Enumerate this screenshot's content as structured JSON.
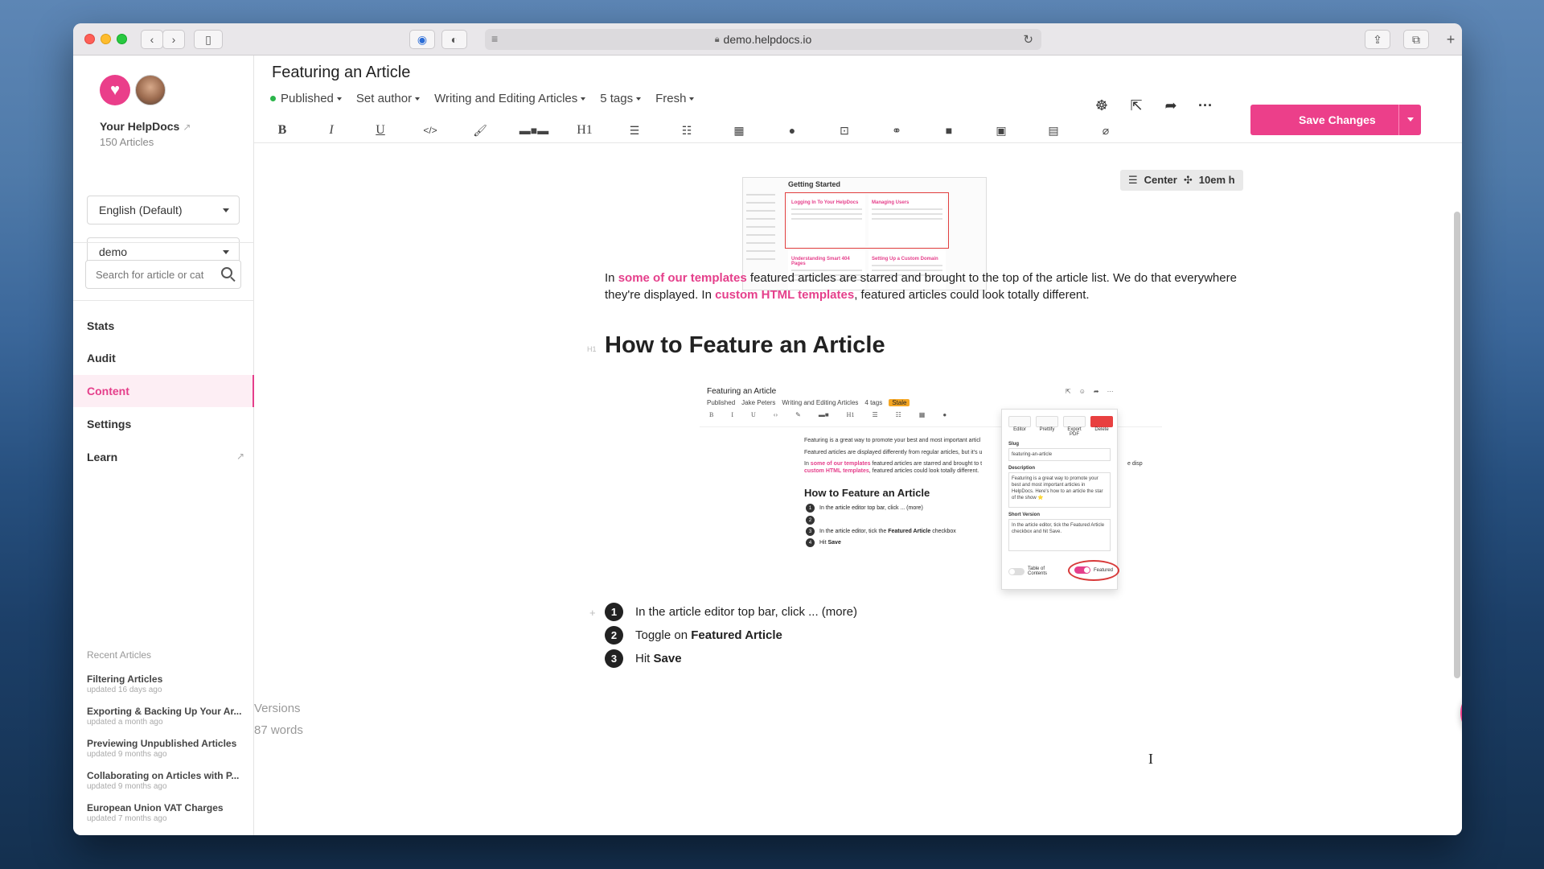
{
  "browser": {
    "url": "demo.helpdocs.io"
  },
  "sidebar": {
    "site_name": "Your HelpDocs",
    "article_count": "150 Articles",
    "language": "English (Default)",
    "site_select": "demo",
    "search_placeholder": "Search for article or cat",
    "nav": [
      {
        "label": "Stats"
      },
      {
        "label": "Audit"
      },
      {
        "label": "Content"
      },
      {
        "label": "Settings"
      },
      {
        "label": "Learn"
      }
    ],
    "recent_heading": "Recent Articles",
    "recent": [
      {
        "title": "Filtering Articles",
        "updated": "updated 16 days ago"
      },
      {
        "title": "Exporting & Backing Up Your Ar...",
        "updated": "updated a month ago"
      },
      {
        "title": "Previewing Unpublished Articles",
        "updated": "updated 9 months ago"
      },
      {
        "title": "Collaborating on Articles with P...",
        "updated": "updated 9 months ago"
      },
      {
        "title": "European Union VAT Charges",
        "updated": "updated 7 months ago"
      }
    ]
  },
  "editor": {
    "title": "Featuring an Article",
    "meta": {
      "status": "Published",
      "author": "Set author",
      "category": "Writing and Editing Articles",
      "tags": "5 tags",
      "freshness": "Fresh"
    },
    "format_buttons": [
      "B",
      "I",
      "U",
      "</>",
      "H1"
    ],
    "save_label": "Save Changes",
    "image_toolbar": {
      "align": "Center",
      "size": "10em h"
    },
    "thumb1": {
      "heading": "Getting Started",
      "cards": [
        "Logging In To Your HelpDocs",
        "Managing Users",
        "Understanding Smart 404 Pages",
        "Setting Up a Custom Domain"
      ]
    },
    "paragraph": {
      "p1": "In ",
      "link1": "some of our templates",
      "p2": " featured articles are starred and brought to the top of the article list. We do that everywhere they're displayed. In ",
      "link2": "custom HTML templates",
      "p3": ", featured articles could look totally different."
    },
    "h_marker": "H1",
    "heading": "How to Feature an Article",
    "shot2": {
      "title": "Featuring an Article",
      "status": "Published",
      "author": "Jake Peters",
      "category": "Writing and Editing Articles",
      "tags": "4 tags",
      "stale": "Stale",
      "line1": "Featuring is a great way to promote your best and most important articl",
      "line2": "Featured articles are displayed differently from regular articles, but it's u",
      "line3_a": "In ",
      "line3_link": "some of our templates",
      "line3_b": " featured articles are starred and brought to t",
      "line3_c": "e disp",
      "line4_link": "custom HTML templates",
      "line4_b": ", featured articles could look totally different.",
      "heading": "How to Feature an Article",
      "steps": [
        {
          "n": "1",
          "text": "In the article editor top bar, click ... (more)"
        },
        {
          "n": "2",
          "text": ""
        },
        {
          "n": "3",
          "text": "In the article editor, tick the ",
          "bold": "Featured Article",
          "after": " checkbox"
        },
        {
          "n": "4",
          "text": "Hit ",
          "bold": "Save",
          "after": ""
        }
      ],
      "panel": {
        "tabs": [
          "Editor",
          "Prettify",
          "Export PDF",
          "Delete"
        ],
        "slug_label": "Slug",
        "slug": "featuring-an-article",
        "desc_label": "Description",
        "desc": "Featuring is a great way to promote your best and most important articles in HelpDocs. Here's how to an article the star of the show ⭐",
        "short_label": "Short Version",
        "short": "In the article editor, tick the Featured Article checkbox and hit Save.",
        "toc": "Table of Contents",
        "featured": "Featured"
      }
    },
    "steps": [
      {
        "n": "1",
        "text": "In the article editor top bar, click ... (more)",
        "bold": ""
      },
      {
        "n": "2",
        "text": "Toggle on ",
        "bold": "Featured Article"
      },
      {
        "n": "3",
        "text": "Hit ",
        "bold": "Save"
      }
    ],
    "versions": "Versions",
    "words": "87 words"
  }
}
